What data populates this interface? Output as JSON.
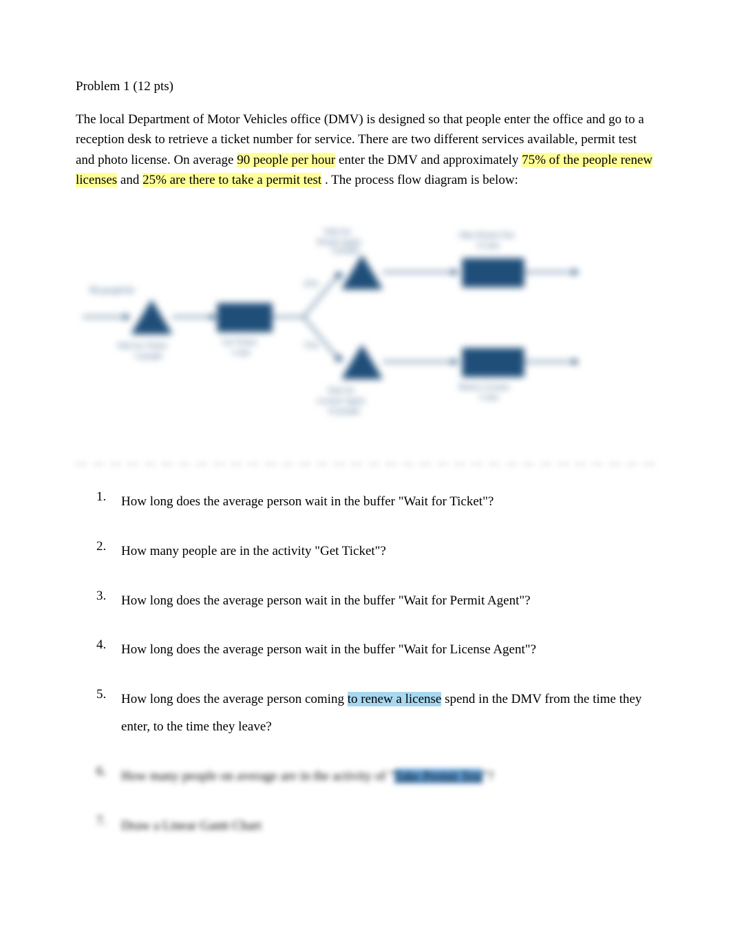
{
  "problem": {
    "title": "Problem 1   (12 pts)",
    "intro_pre": "The local Department of Motor Vehicles office (DMV) is designed so that people enter the office and go to a reception desk to retrieve a ticket number for service.    There are two different services available, permit test and photo license.    On average ",
    "intro_h1": "90 people per hour",
    "intro_mid1": "   enter the DMV and approximately  ",
    "intro_h2": "75% of the people renew licenses",
    "intro_mid2": "   and  ",
    "intro_h3": "25% are there to take a permit test",
    "intro_mid3": "   .    The process flow diagram is below:"
  },
  "diagram": {
    "entry_label": "90 people/hr",
    "buffer_ticket": "Wait for Ticket 5 people",
    "activity_get_ticket": "Get Ticket 1 min",
    "split_permit": "25%",
    "split_license": "75%",
    "buffer_permit": "Wait for Permit Agent 3 people",
    "activity_permit": "Take Permit Test 15 min",
    "buffer_license": "Wait for License Agent 10 people",
    "activity_license": "Renew License 5 min"
  },
  "blur_divider": "— — — — — — — — — — — — — — — — — — — — — — — — — — — — — — — — — —",
  "questions": {
    "q1": {
      "num": "1.",
      "text": "How long does the average person wait in the buffer \"Wait for Ticket\"?"
    },
    "q2": {
      "num": "2.",
      "text": "How many people are in the activity \"Get Ticket\"?"
    },
    "q3": {
      "num": "3.",
      "text": "How long does the average person wait in the buffer \"Wait for   Permit Agent\"?"
    },
    "q4": {
      "num": "4.",
      "text": "How long does the average person wait in the buffer \"Wait for   License Agent\"?"
    },
    "q5": {
      "num": "5.",
      "pre": "How long does the average person coming  ",
      "h": "to renew a license",
      "post": "   spend in the DMV from the time they enter, to the time they leave?"
    },
    "q6": {
      "num": "6.",
      "pre": "How many people on average are in the activity of \"",
      "h": "Take Permit Test",
      "post": "\"?"
    },
    "q7": {
      "num": "7.",
      "text": "Draw a Linear Gantt Chart"
    }
  }
}
